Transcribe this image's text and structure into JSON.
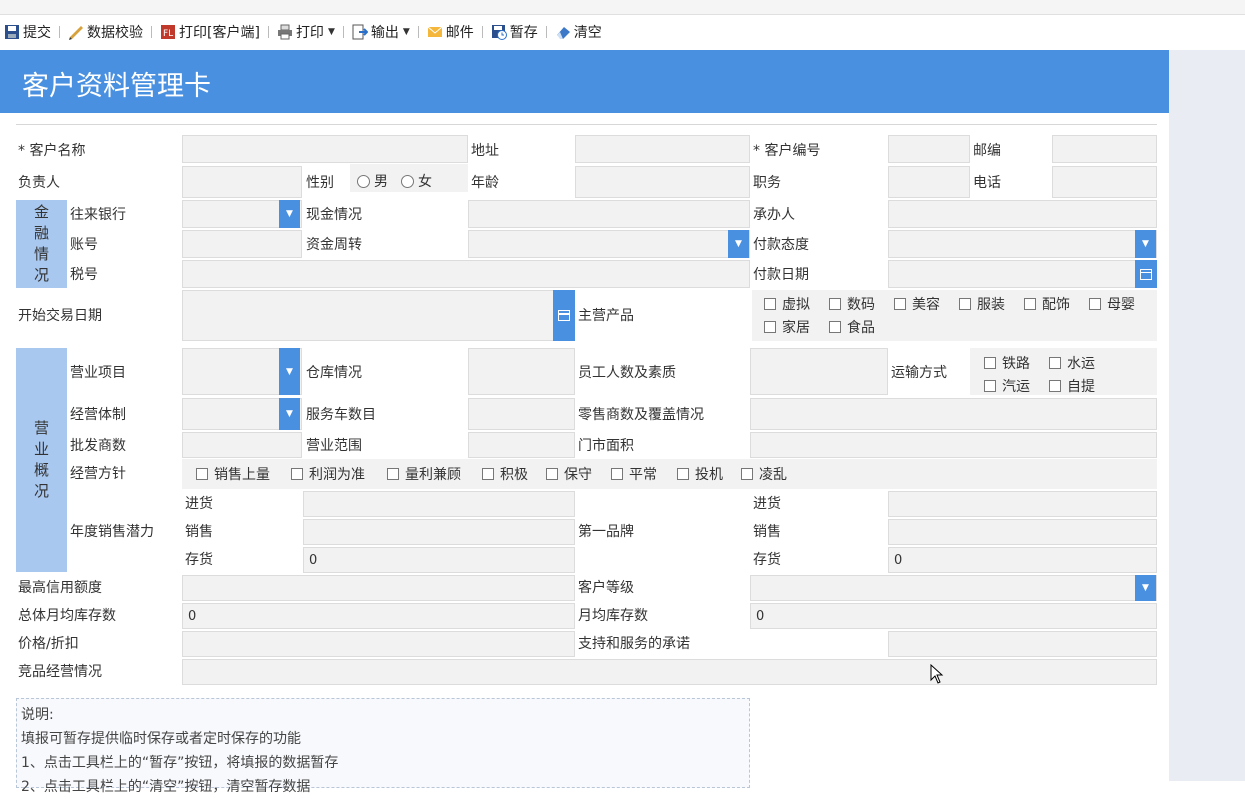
{
  "toolbar": {
    "submit": "提交",
    "validate": "数据校验",
    "print_client": "打印[客户端]",
    "print": "打印",
    "export": "输出",
    "mail": "邮件",
    "save_temp": "暂存",
    "clear": "清空"
  },
  "header": {
    "title": "客户资料管理卡"
  },
  "labels": {
    "customer_name": "* 客户名称",
    "address": "地址",
    "customer_no": "* 客户编号",
    "postcode": "邮编",
    "manager": "负责人",
    "gender": "性别",
    "male": "男",
    "female": "女",
    "age": "年龄",
    "position": "职务",
    "phone": "电话",
    "finance_band": [
      "金",
      "融",
      "情",
      "况"
    ],
    "bank": "往来银行",
    "cash": "现金情况",
    "handler": "承办人",
    "account": "账号",
    "fund_turnover": "资金周转",
    "pay_attitude": "付款态度",
    "tax_no": "税号",
    "pay_date": "付款日期",
    "start_date": "开始交易日期",
    "main_products": "主营产品",
    "business_band": [
      "营",
      "业",
      "概",
      "况"
    ],
    "business_item": "营业项目",
    "warehouse": "仓库情况",
    "staff": "员工人数及素质",
    "transport": "运输方式",
    "mgmt_system": "经营体制",
    "service_cars": "服务车数目",
    "retailers": "零售商数及覆盖情况",
    "wholesalers": "批发商数",
    "business_scope": "营业范围",
    "store_area": "门市面积",
    "policy": "经营方针",
    "annual_potential": "年度销售潜力",
    "purchase": "进货",
    "sales": "销售",
    "stock": "存货",
    "first_brand": "第一品牌",
    "credit_limit": "最高信用额度",
    "customer_level": "客户等级",
    "total_monthly_stock": "总体月均库存数",
    "monthly_stock": "月均库存数",
    "price_discount": "价格/折扣",
    "support_commitment": "支持和服务的承诺",
    "competitor": "竞品经营情况"
  },
  "products": [
    "虚拟",
    "数码",
    "美容",
    "服装",
    "配饰",
    "母婴",
    "家居",
    "食品"
  ],
  "transport_options": [
    "铁路",
    "水运",
    "汽运",
    "自提"
  ],
  "policy_options": [
    "销售上量",
    "利润为准",
    "量利兼顾",
    "积极",
    "保守",
    "平常",
    "投机",
    "凌乱"
  ],
  "values": {
    "stock_left": "0",
    "stock_right": "0",
    "total_monthly_stock": "0",
    "monthly_stock": "0"
  },
  "notes": {
    "title": "说明:",
    "line1": "填报可暂存提供临时保存或者定时保存的功能",
    "line2": "1、点击工具栏上的“暂存”按钮，将填报的数据暂存",
    "line3": "2、点击工具栏上的“清空”按钮，清空暂存数据"
  },
  "colors": {
    "accent": "#4a90e0",
    "band": "#a9c8ef",
    "field": "#f2f2f2"
  }
}
